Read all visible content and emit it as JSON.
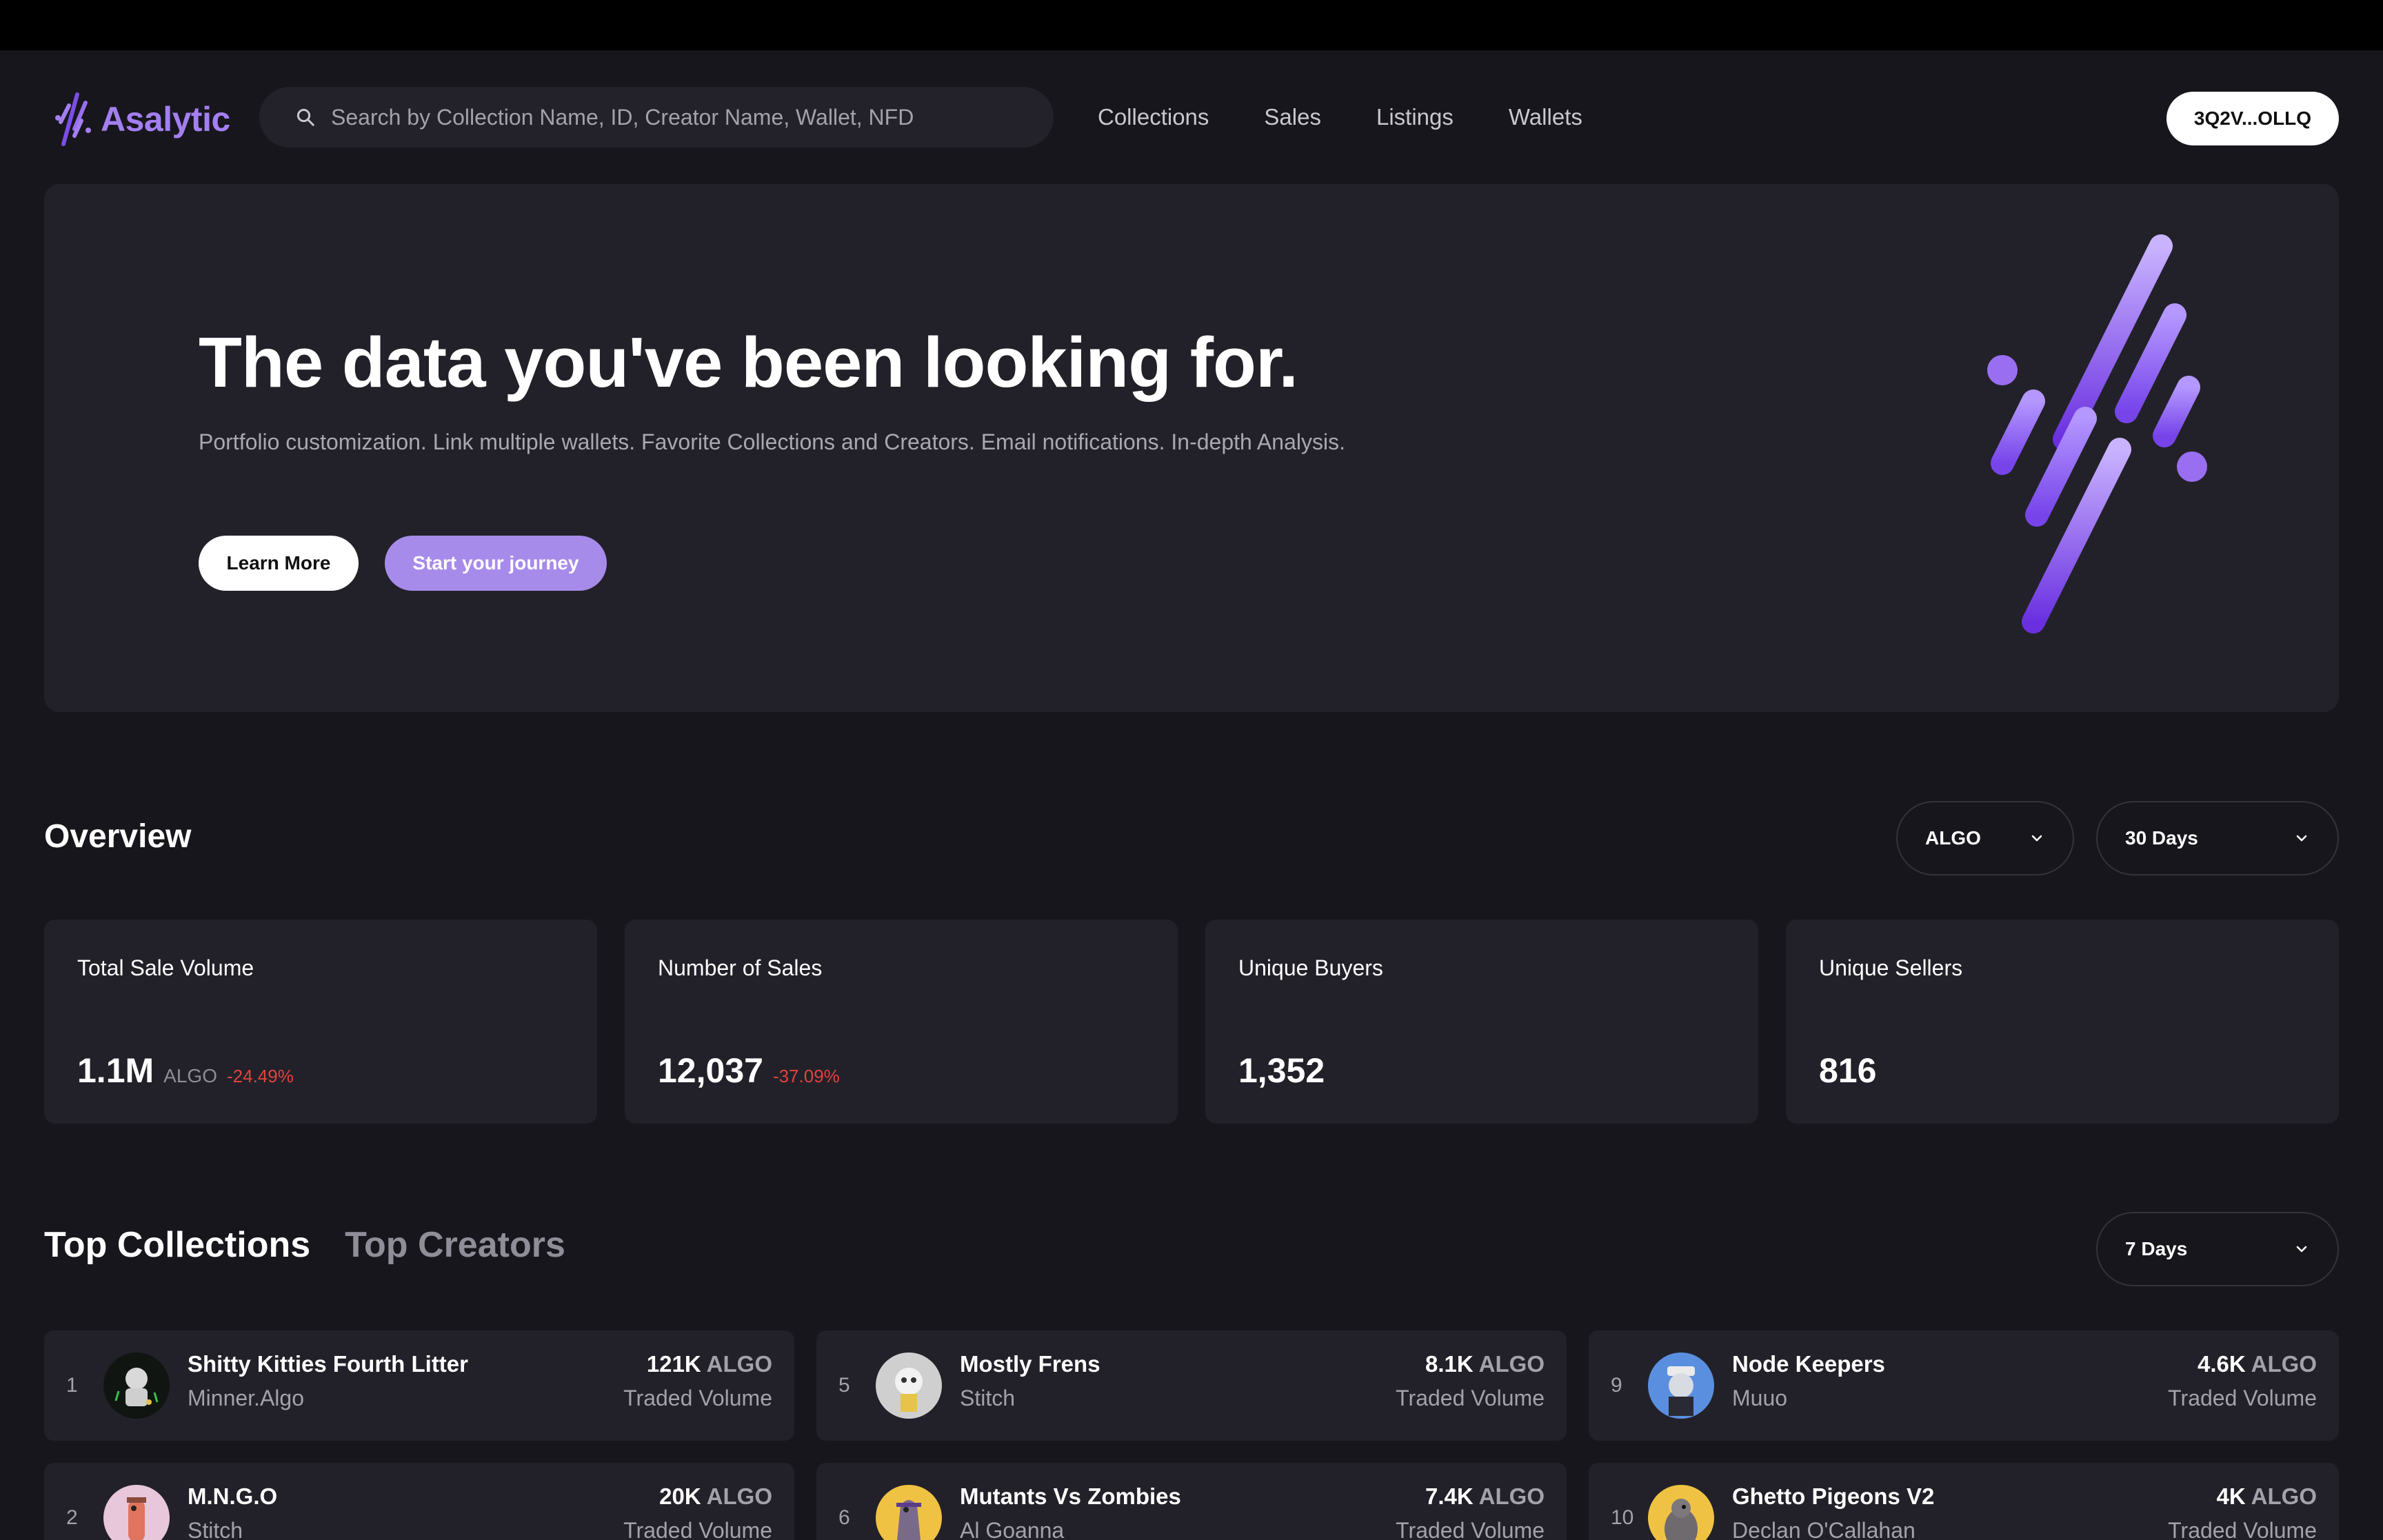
{
  "app": {
    "name": "Asalytic",
    "brand_color": "#a37ff0"
  },
  "search": {
    "placeholder": "Search by Collection Name, ID, Creator Name, Wallet, NFD",
    "icon": "search-icon"
  },
  "nav": {
    "items": [
      "Collections",
      "Sales",
      "Listings",
      "Wallets"
    ]
  },
  "wallet": {
    "label": "3Q2V...OLLQ"
  },
  "hero": {
    "title": "The data you've been looking for.",
    "subtitle": "Portfolio customization. Link multiple wallets. Favorite Collections and Creators. Email notifications. In-depth Analysis.",
    "learn_more": "Learn More",
    "start": "Start your journey"
  },
  "overview": {
    "title": "Overview",
    "currency_select": "ALGO",
    "period_select": "30 Days",
    "stats": [
      {
        "label": "Total Sale Volume",
        "value": "1.1M",
        "unit": "ALGO",
        "change": "-24.49%"
      },
      {
        "label": "Number of Sales",
        "value": "12,037",
        "unit": "",
        "change": "-37.09%"
      },
      {
        "label": "Unique Buyers",
        "value": "1,352",
        "unit": "",
        "change": ""
      },
      {
        "label": "Unique Sellers",
        "value": "816",
        "unit": "",
        "change": ""
      }
    ]
  },
  "top": {
    "tab_collections": "Top Collections",
    "tab_creators": "Top Creators",
    "period_select": "7 Days",
    "volume_label": "Traded Volume",
    "collections": [
      {
        "rank": "1",
        "name": "Shitty Kitties Fourth Litter",
        "creator": "Minner.Algo",
        "volume": "121K",
        "unit": "ALGO"
      },
      {
        "rank": "2",
        "name": "M.N.G.O",
        "creator": "Stitch",
        "volume": "20K",
        "unit": "ALGO"
      },
      {
        "rank": "5",
        "name": "Mostly Frens",
        "creator": "Stitch",
        "volume": "8.1K",
        "unit": "ALGO"
      },
      {
        "rank": "6",
        "name": "Mutants Vs Zombies",
        "creator": "Al Goanna",
        "volume": "7.4K",
        "unit": "ALGO"
      },
      {
        "rank": "9",
        "name": "Node Keepers",
        "creator": "Muuo",
        "volume": "4.6K",
        "unit": "ALGO"
      },
      {
        "rank": "10",
        "name": "Ghetto Pigeons V2",
        "creator": "Declan O'Callahan",
        "volume": "4K",
        "unit": "ALGO"
      }
    ]
  }
}
